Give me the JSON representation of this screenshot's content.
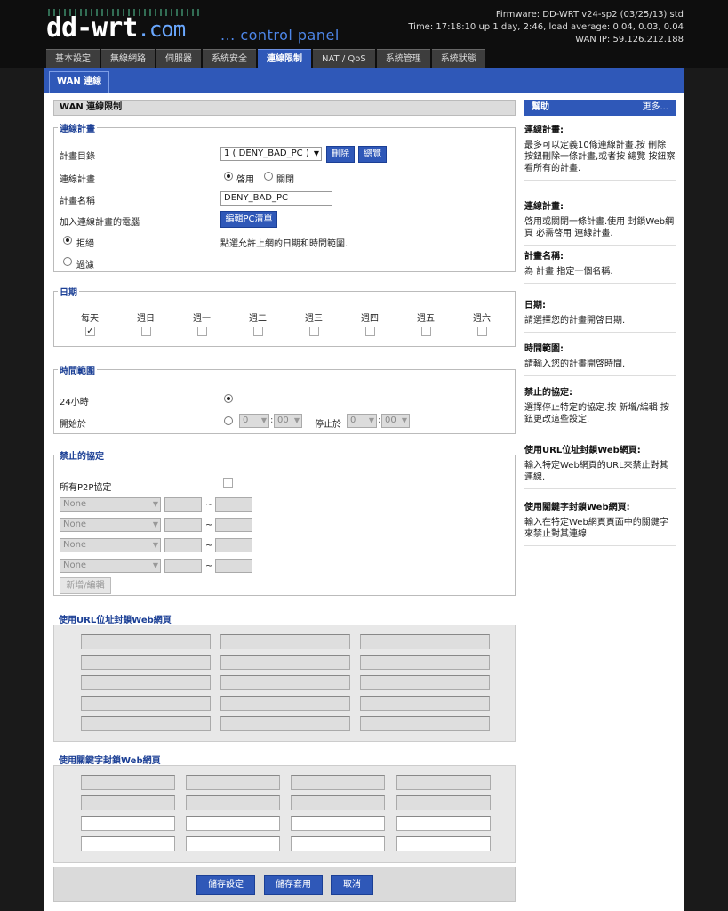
{
  "header": {
    "logo": "dd-wrt.com",
    "tagline": "... control panel",
    "firmware": "Firmware: DD-WRT v24-sp2 (03/25/13) std",
    "time": "Time: 17:18:10 up 1 day, 2:46, load average: 0.04, 0.03, 0.04",
    "wan_ip": "WAN IP: 59.126.212.188"
  },
  "tabs": [
    "基本設定",
    "無線網路",
    "伺服器",
    "系統安全",
    "連線限制",
    "NAT / QoS",
    "系統管理",
    "系統狀態"
  ],
  "active_tab": "連線限制",
  "subtab": "WAN 連線",
  "main": {
    "title": "WAN 連線限制",
    "policy": {
      "legend": "連線計畫",
      "profile_label": "計畫目錄",
      "profile_value": "1 ( DENY_BAD_PC )",
      "delete_btn": "刪除",
      "summary_btn": "總覽",
      "status_label": "連線計畫",
      "enable_label": "啓用",
      "disable_label": "關閉",
      "status": "enable",
      "name_label": "計畫名稱",
      "name_value": "DENY_BAD_PC",
      "pcs_label": "加入連線計畫的電腦",
      "edit_pc_btn": "編輯PC清單",
      "deny_label": "拒絕",
      "filter_label": "過濾",
      "action": "deny",
      "note": "點選允許上網的日期和時間範圍."
    },
    "days": {
      "legend": "日期",
      "labels": [
        "每天",
        "週日",
        "週一",
        "週二",
        "週三",
        "週四",
        "週五",
        "週六"
      ],
      "checked": [
        true,
        false,
        false,
        false,
        false,
        false,
        false,
        false
      ]
    },
    "times": {
      "legend": "時間範圍",
      "h24_label": "24小時",
      "start_label": "開始於",
      "stop_label": "停止於",
      "start_hour": "0",
      "start_min": "00",
      "stop_hour": "0",
      "stop_min": "00",
      "mode": "24h"
    },
    "services": {
      "legend": "禁止的協定",
      "p2p_label": "所有P2P協定",
      "rows": [
        {
          "service": "None",
          "tilde": "~"
        },
        {
          "service": "None",
          "tilde": "~"
        },
        {
          "service": "None",
          "tilde": "~"
        },
        {
          "service": "None",
          "tilde": "~"
        }
      ],
      "add_edit_btn": "新增/編輯"
    },
    "url_block": {
      "legend": "使用URL位址封鎖Web網頁"
    },
    "keyword_block": {
      "legend": "使用關鍵字封鎖Web網頁"
    },
    "buttons": {
      "save": "儲存設定",
      "apply": "儲存套用",
      "cancel": "取消"
    }
  },
  "help": {
    "title": "幫助",
    "more": "更多...",
    "sections": [
      {
        "title": "連線計畫:",
        "body": "最多可以定義10條連線計畫.按 刪除 按鈕刪除一條計畫,或者按 總覽 按鈕察看所有的計畫."
      },
      {
        "title": "連線計畫:",
        "body": "啓用或關閉一條計畫.使用 封鎖Web網頁 必需啓用 連線計畫."
      },
      {
        "title": "計畫名稱:",
        "body": "為 計畫 指定一個名稱."
      },
      {
        "title": "日期:",
        "body": "請選擇您的計畫開啓日期."
      },
      {
        "title": "時間範圍:",
        "body": "請輸入您的計畫開啓時間."
      },
      {
        "title": "禁止的協定:",
        "body": "選擇停止特定的協定.按 新增/編輯 按鈕更改這些設定."
      },
      {
        "title": "使用URL位址封鎖Web網頁:",
        "body": "輸入特定Web網頁的URL來禁止對其連線."
      },
      {
        "title": "使用關鍵字封鎖Web網頁:",
        "body": "輸入在特定Web網頁頁面中的關鍵字來禁止對其連線."
      }
    ]
  },
  "colors": {
    "accent": "#2f58b8",
    "legend": "#1b3f95",
    "dark_bg": "#1a1a1a"
  }
}
